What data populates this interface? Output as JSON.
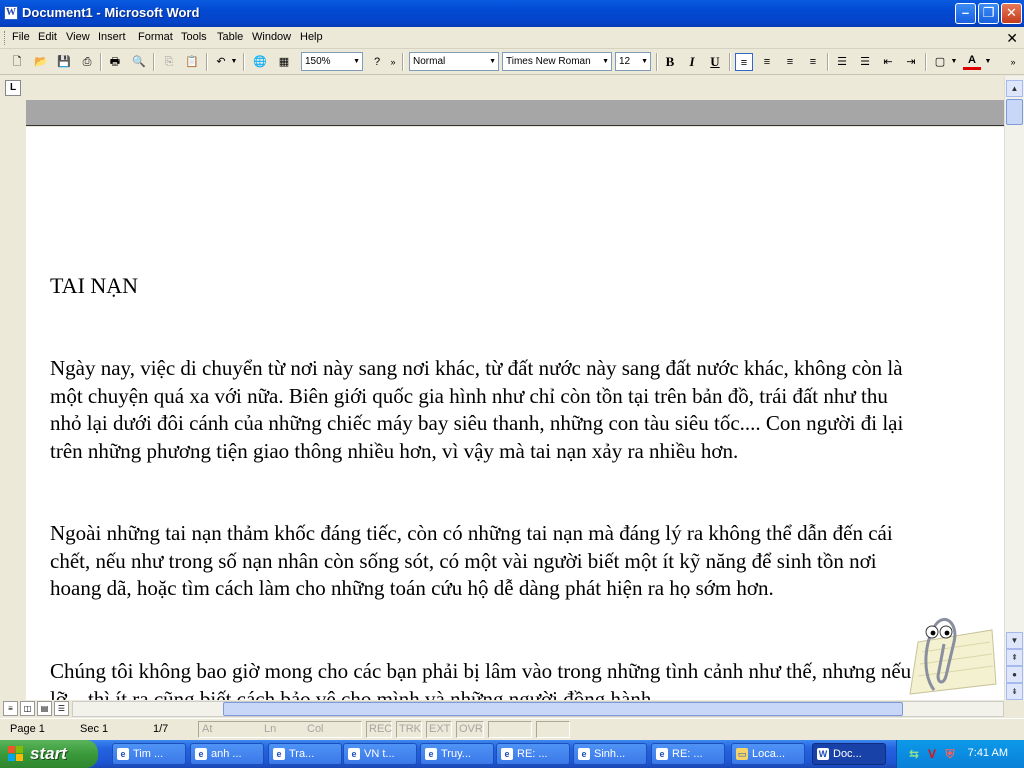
{
  "window": {
    "title": "Document1 - Microsoft Word",
    "app_icon_glyph": "W"
  },
  "menu": [
    "File",
    "Edit",
    "View",
    "Insert",
    "Format",
    "Tools",
    "Table",
    "Window",
    "Help"
  ],
  "toolbar": {
    "zoom": "150%",
    "style": "Normal",
    "font": "Times New Roman",
    "size": "12",
    "bold": "B",
    "italic": "I",
    "underline": "U",
    "font_color_glyph": "A"
  },
  "document": {
    "title": "TAI NẠN",
    "paragraphs": [
      "Ngày nay, việc di chuyển từ nơi này sang nơi khác, từ đất nước này sang đất nước khác, không còn là một chuyện quá xa với nữa. Biên giới quốc gia hình như chỉ còn tồn tại trên bản đồ, trái đất như thu nhỏ lại dưới đôi cánh của những chiếc máy bay siêu thanh, những con tàu siêu tốc.... Con người đi lại trên những phương tiện giao thông nhiều hơn, vì vậy mà tai nạn xảy ra nhiều hơn.",
      "Ngoài những tai nạn thảm khốc đáng tiếc, còn có những tai nạn mà đáng lý ra không thể dẫn đến cái chết, nếu như trong số nạn nhân còn sống sót, có một vài người biết một ít kỹ năng để sinh tồn nơi hoang dã, hoặc tìm cách làm cho những toán cứu hộ dễ dàng phát hiện ra họ sớm hơn.",
      "Chúng tôi không bao giờ mong cho các bạn phải bị lâm vào trong những tình cảnh như thế, nhưng nếu lỡ... thì ít ra cũng biết cách bảo vệ cho mình và những người đồng hành"
    ]
  },
  "statusbar": {
    "page": "Page 1",
    "sec": "Sec 1",
    "pages": "1/7",
    "at": "At",
    "ln": "Ln",
    "col": "Col",
    "rec": "REC",
    "trk": "TRK",
    "ext": "EXT",
    "ovr": "OVR"
  },
  "taskbar": {
    "start": "start",
    "tasks": [
      "Tim ...",
      "anh ...",
      "Tra...",
      "VN t...",
      "Truy...",
      "RE: ...",
      "Sinh...",
      "RE: ...",
      "Loca...",
      "Doc..."
    ],
    "clock": "7:41 AM"
  }
}
